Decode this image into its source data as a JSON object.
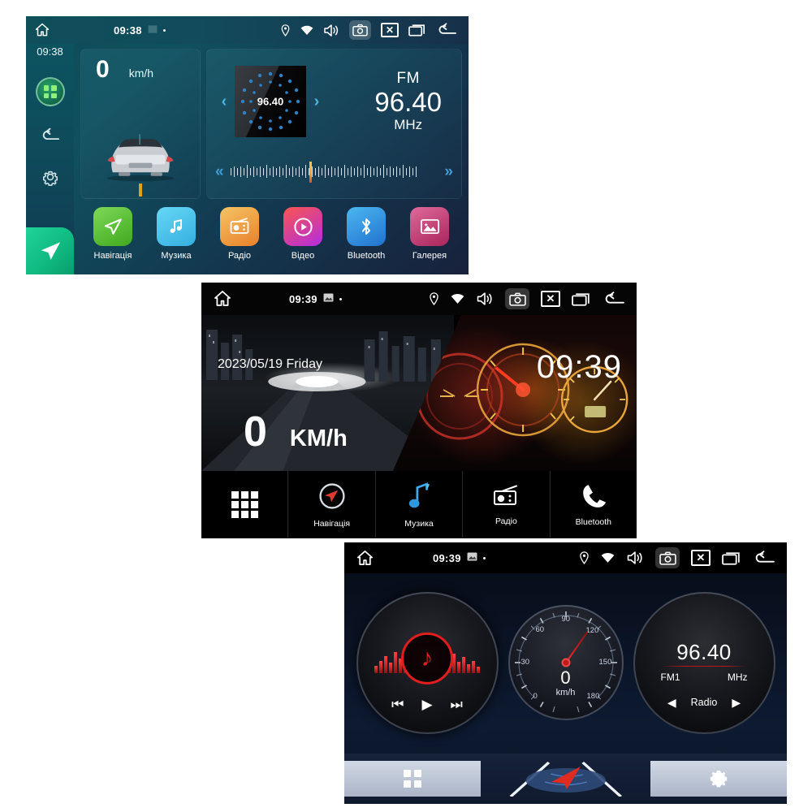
{
  "screens": [
    {
      "id": "screen-1-teal-home",
      "statusbar": {
        "home_icon": "home-icon",
        "time": "09:38",
        "icons": [
          "gallery-icon",
          "dot-icon",
          "location-icon",
          "wifi-icon",
          "volume-icon",
          "screenshot-icon",
          "close-icon",
          "recents-icon",
          "back-icon"
        ]
      },
      "sidebar": {
        "time": "09:38",
        "items": [
          {
            "name": "apps-grid-icon",
            "label": "Apps"
          },
          {
            "name": "back-icon",
            "label": "Back"
          },
          {
            "name": "settings-gear-icon",
            "label": "Settings"
          },
          {
            "name": "navigation-icon",
            "label": "Navigation"
          }
        ]
      },
      "speed_widget": {
        "value": "0",
        "unit": "km/h"
      },
      "radio_widget": {
        "album_frequency": "96.40",
        "band": "FM",
        "frequency": "96.40",
        "unit": "MHz",
        "prev_label": "‹",
        "next_label": "›",
        "seek_back": "«",
        "seek_fwd": "»"
      },
      "apps": [
        {
          "label": "Навігація",
          "icon": "navigation-icon",
          "color": "#63c832"
        },
        {
          "label": "Музика",
          "icon": "music-note-icon",
          "color": "#4cc3ec"
        },
        {
          "label": "Радіо",
          "icon": "radio-icon",
          "color": "#eea23a"
        },
        {
          "label": "Відео",
          "icon": "video-play-icon",
          "color": "#e8497a"
        },
        {
          "label": "Bluetooth",
          "icon": "bluetooth-icon",
          "color": "#2f93e0"
        },
        {
          "label": "Галерея",
          "icon": "gallery-image-icon",
          "color": "#c73c74"
        }
      ]
    },
    {
      "id": "screen-2-black-home",
      "statusbar": {
        "home_icon": "home-icon",
        "time": "09:39",
        "icons": [
          "gallery-icon",
          "dot-icon",
          "location-icon",
          "wifi-icon",
          "volume-icon",
          "screenshot-icon",
          "close-icon",
          "recents-icon",
          "back-icon"
        ]
      },
      "hero": {
        "date": "2023/05/19 Friday",
        "clock": "09:39",
        "speed": "0",
        "speed_unit": "KM/h"
      },
      "dock": [
        {
          "label": "",
          "icon": "apps-grid-icon"
        },
        {
          "label": "Навігація",
          "icon": "compass-icon"
        },
        {
          "label": "Музика",
          "icon": "music-note-icon"
        },
        {
          "label": "Радіо",
          "icon": "radio-icon"
        },
        {
          "label": "Bluetooth",
          "icon": "phone-handset-icon"
        }
      ]
    },
    {
      "id": "screen-3-gauges",
      "statusbar": {
        "home_icon": "home-icon",
        "time": "09:39",
        "icons": [
          "gallery-icon",
          "dot-icon",
          "location-icon",
          "wifi-icon",
          "volume-icon",
          "screenshot-icon",
          "close-icon",
          "recents-icon",
          "back-icon"
        ]
      },
      "music_gauge": {
        "icon": "music-note-icon",
        "prev": "⏮",
        "play": "▶",
        "next": "⏭"
      },
      "speed_gauge": {
        "value": "0",
        "unit": "km/h",
        "ticks": [
          "0",
          "30",
          "60",
          "90",
          "120",
          "150",
          "180"
        ]
      },
      "radio_gauge": {
        "frequency": "96.40",
        "band": "FM1",
        "unit": "MHz",
        "prev": "◀",
        "label": "Radio",
        "next": "▶"
      },
      "dock": [
        {
          "name": "apps-grid-icon"
        },
        {
          "name": "navigation-arrow-icon"
        },
        {
          "name": "settings-gear-icon"
        }
      ]
    }
  ],
  "chart_data": {
    "type": "table",
    "title": "Car head unit speed gauge",
    "categories": [
      "0",
      "30",
      "60",
      "90",
      "120",
      "150",
      "180"
    ],
    "values": [
      0
    ],
    "xlabel": "km/h",
    "ylabel": "",
    "ylim": [
      0,
      180
    ]
  }
}
